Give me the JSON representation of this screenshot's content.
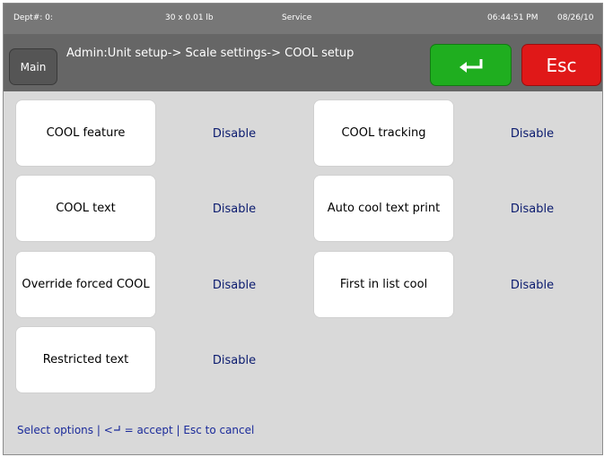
{
  "status_bar": {
    "dept": "Dept#: 0:",
    "weight": "30 x 0.01 lb",
    "mode": "Service",
    "time": "06:44:51 PM",
    "date": "08/26/10"
  },
  "header": {
    "main_label": "Main",
    "breadcrumb": "Admin:Unit setup-> Scale settings-> COOL setup",
    "enter_icon": "enter-return-icon",
    "esc_label": "Esc"
  },
  "options": [
    {
      "label": "COOL feature",
      "value": "Disable"
    },
    {
      "label": "COOL text",
      "value": "Disable"
    },
    {
      "label": "Override forced COOL",
      "value": "Disable"
    },
    {
      "label": "Restricted text",
      "value": "Disable"
    },
    {
      "label": "COOL tracking",
      "value": "Disable"
    },
    {
      "label": "Auto cool text print",
      "value": "Disable"
    },
    {
      "label": "First in list cool",
      "value": "Disable"
    }
  ],
  "footer": {
    "hint_prefix": "Select options | <",
    "hint_suffix": " = accept | Esc to cancel"
  },
  "colors": {
    "enter_button": "#1fae1f",
    "esc_button": "#e01818",
    "value_text": "#0a1a6e",
    "hint_text": "#1a2a9a"
  }
}
